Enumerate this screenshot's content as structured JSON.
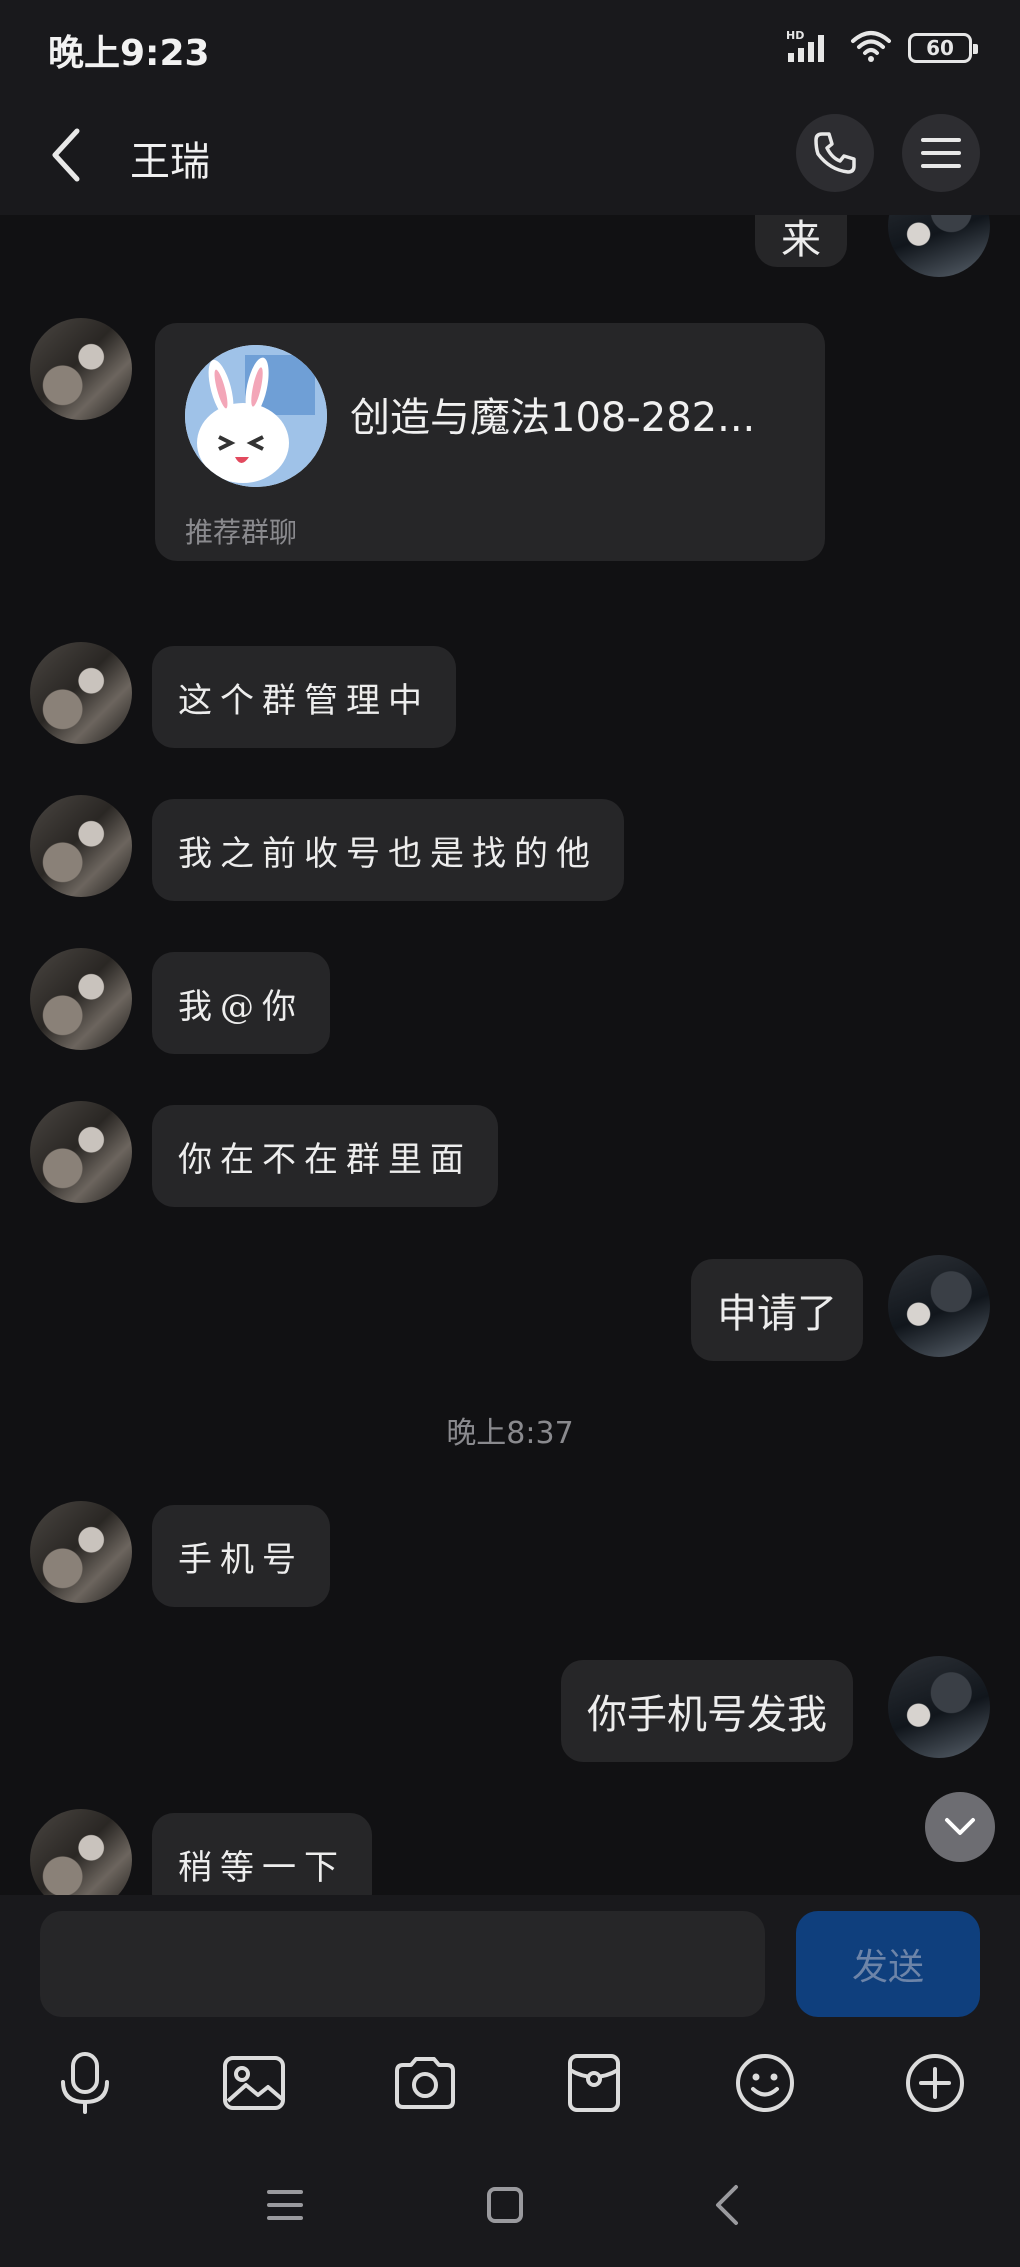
{
  "status_bar": {
    "time": "晚上9:23",
    "network": "HD",
    "battery": "60"
  },
  "header": {
    "title": "王瑞"
  },
  "messages": {
    "partial_top_text": "来",
    "group_card": {
      "name": "创造与魔法108-282...",
      "tag": "推荐群聊"
    },
    "msg1": "这个群管理中",
    "msg2": "我之前收号也是找的他",
    "msg3": "我@你",
    "msg4": "你在不在群里面",
    "msg5": "申请了",
    "time_divider": "晚上8:37",
    "msg6": "手机号",
    "msg7": "你手机号发我",
    "msg8": "稍等一下"
  },
  "input": {
    "value": "",
    "placeholder": "",
    "send_label": "发送"
  },
  "toolbar": {
    "icons": [
      "microphone-icon",
      "image-icon",
      "camera-icon",
      "red-packet-icon",
      "emoji-icon",
      "plus-icon"
    ]
  },
  "colors": {
    "background": "#111113",
    "bubble": "#262628",
    "send_button": "#0f3f7d",
    "bar": "#19191c"
  }
}
